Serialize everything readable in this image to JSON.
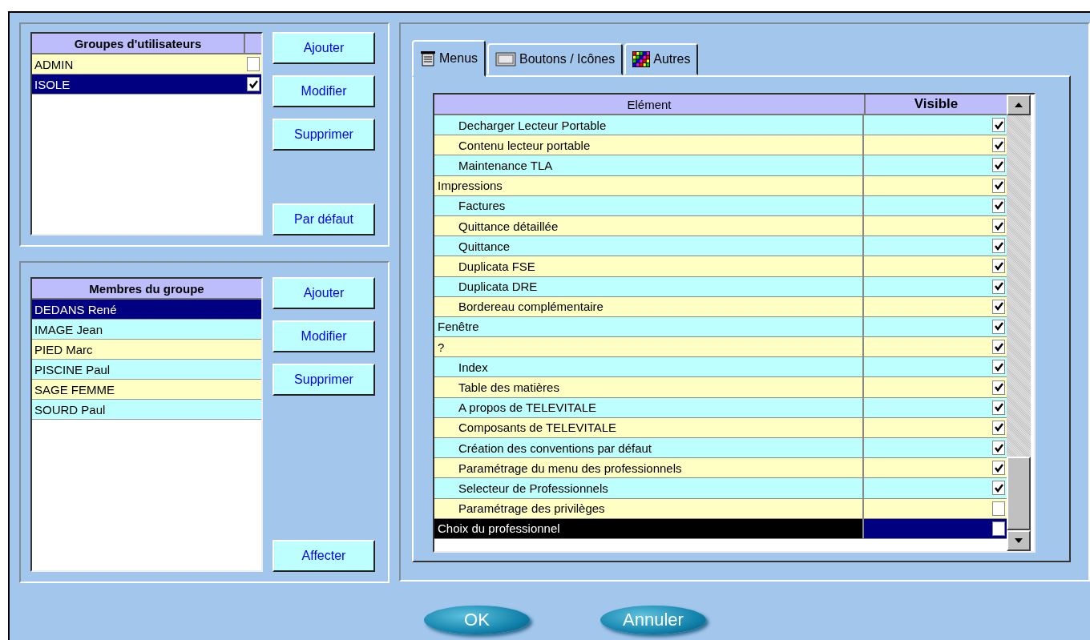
{
  "groups": {
    "header": "Groupes d'utilisateurs",
    "items": [
      {
        "label": "ADMIN",
        "checked": false,
        "selected": false
      },
      {
        "label": "ISOLE",
        "checked": true,
        "selected": true
      }
    ],
    "buttons": [
      "Ajouter",
      "Modifier",
      "Supprimer",
      "Par défaut"
    ]
  },
  "members": {
    "header": "Membres du groupe",
    "items": [
      {
        "label": "DEDANS René",
        "selected": true
      },
      {
        "label": "IMAGE Jean",
        "selected": false
      },
      {
        "label": "PIED Marc",
        "selected": false
      },
      {
        "label": "PISCINE Paul",
        "selected": false
      },
      {
        "label": "SAGE FEMME",
        "selected": false
      },
      {
        "label": "SOURD Paul",
        "selected": false
      }
    ],
    "buttons": [
      "Ajouter",
      "Modifier",
      "Supprimer",
      "Affecter"
    ]
  },
  "tabs": [
    {
      "label": "Menus",
      "selected": true,
      "kind": "menu"
    },
    {
      "label": "Boutons / Icônes",
      "selected": false,
      "kind": "ok"
    },
    {
      "label": "Autres",
      "selected": false,
      "kind": "grid"
    }
  ],
  "table": {
    "columns": [
      "Elément",
      "Visible"
    ],
    "rows": [
      {
        "children": [
          {
            "label": "Decharger Lecteur Portable",
            "visible": true,
            "selected": false
          },
          {
            "label": "Contenu lecteur portable",
            "visible": true,
            "selected": false
          },
          {
            "label": "Maintenance TLA",
            "visible": true,
            "selected": false
          }
        ]
      },
      {
        "label": "Impressions",
        "visible": true,
        "selected": false,
        "children": [
          {
            "label": "Factures",
            "visible": true,
            "selected": false
          },
          {
            "label": "Quittance détaillée",
            "visible": true,
            "selected": false
          },
          {
            "label": "Quittance",
            "visible": true,
            "selected": false
          },
          {
            "label": "Duplicata FSE",
            "visible": true,
            "selected": false
          },
          {
            "label": "Duplicata DRE",
            "visible": true,
            "selected": false
          },
          {
            "label": "Bordereau complémentaire",
            "visible": true,
            "selected": false
          }
        ]
      },
      {
        "label": "Fenêtre",
        "visible": true,
        "selected": false
      },
      {
        "label": "?",
        "visible": true,
        "selected": false,
        "children": [
          {
            "label": "Index",
            "visible": true,
            "selected": false
          },
          {
            "label": "Table des matières",
            "visible": true,
            "selected": false
          },
          {
            "label": "A propos de TELEVITALE",
            "visible": true,
            "selected": false
          },
          {
            "label": "Composants de TELEVITALE",
            "visible": true,
            "selected": false
          },
          {
            "label": "Création des conventions par défaut",
            "visible": true,
            "selected": false
          },
          {
            "label": "Paramétrage du menu des professionnels",
            "visible": true,
            "selected": false
          },
          {
            "label": "Selecteur de Professionnels",
            "visible": true,
            "selected": false
          },
          {
            "label": "Paramétrage des privilèges",
            "visible": false,
            "selected": false
          }
        ]
      },
      {
        "label": "Choix du professionnel",
        "visible": false,
        "selected": true
      }
    ]
  },
  "buttons": [
    "OK",
    "Annuler"
  ]
}
